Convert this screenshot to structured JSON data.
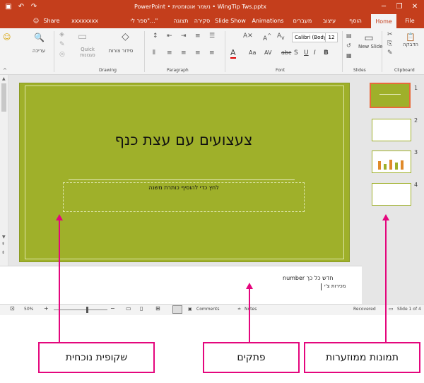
{
  "titlebar": {
    "doc_title": "PowerPoint • נשמר אוטומטית • WingTip Tws.pptx",
    "minimize": "─",
    "restore": "❐",
    "close": "✕",
    "help": "?"
  },
  "tabs": [
    {
      "label": "File"
    },
    {
      "label": "Home"
    },
    {
      "label": "הוסף"
    },
    {
      "label": "עיצוב"
    },
    {
      "label": "מעברים"
    },
    {
      "label": "Animations"
    },
    {
      "label": "Slide Show"
    },
    {
      "label": "סקירה"
    },
    {
      "label": "תצוגה"
    },
    {
      "label": "ספר לי\"...\""
    }
  ],
  "share": "Share",
  "user_name": "xxxxxxxx",
  "ribbon": {
    "groups": {
      "clipboard": "Clipboard",
      "slides": "Slides",
      "font": "Font",
      "paragraph": "Paragraph",
      "drawing": "Drawing"
    },
    "paste": "הדבקה",
    "new_slide": "New Slide",
    "font_name": "Calibri (Body)",
    "font_size": "12",
    "arrange": "סידור צורות",
    "quick_styles": "Quick",
    "quick_styles_2": "סגנונות",
    "editing": "עריכה"
  },
  "slide": {
    "title": "צעצועים עם עצת כנף",
    "subtitle": "לחץ כדי להוסיף כותרת משנה"
  },
  "thumbnails": [
    "1",
    "2",
    "3",
    "4"
  ],
  "notes": {
    "line1": "חדש כל כך ",
    "line1_en": "number",
    "line2": "מכירות צ'י"
  },
  "status": {
    "slide": "Slide 1 of 4",
    "recovered": "Recovered",
    "notes": "Notes",
    "comments": "Comments",
    "zoom": "50%"
  },
  "callouts": {
    "notes_pane": "שקופית נוכחית",
    "notes": "פתקים",
    "thumbnails": "תמונות ממוזערות"
  },
  "colors": {
    "accent": "#c43e1c",
    "slide_bg": "#9fb02a",
    "callout": "#e4067d"
  }
}
